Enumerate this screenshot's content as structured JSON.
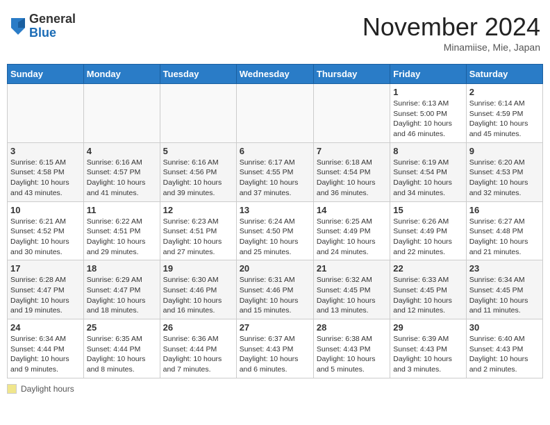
{
  "header": {
    "logo_general": "General",
    "logo_blue": "Blue",
    "month_title": "November 2024",
    "location": "Minamiise, Mie, Japan"
  },
  "weekdays": [
    "Sunday",
    "Monday",
    "Tuesday",
    "Wednesday",
    "Thursday",
    "Friday",
    "Saturday"
  ],
  "weeks": [
    [
      {
        "day": "",
        "info": ""
      },
      {
        "day": "",
        "info": ""
      },
      {
        "day": "",
        "info": ""
      },
      {
        "day": "",
        "info": ""
      },
      {
        "day": "",
        "info": ""
      },
      {
        "day": "1",
        "info": "Sunrise: 6:13 AM\nSunset: 5:00 PM\nDaylight: 10 hours and 46 minutes."
      },
      {
        "day": "2",
        "info": "Sunrise: 6:14 AM\nSunset: 4:59 PM\nDaylight: 10 hours and 45 minutes."
      }
    ],
    [
      {
        "day": "3",
        "info": "Sunrise: 6:15 AM\nSunset: 4:58 PM\nDaylight: 10 hours and 43 minutes."
      },
      {
        "day": "4",
        "info": "Sunrise: 6:16 AM\nSunset: 4:57 PM\nDaylight: 10 hours and 41 minutes."
      },
      {
        "day": "5",
        "info": "Sunrise: 6:16 AM\nSunset: 4:56 PM\nDaylight: 10 hours and 39 minutes."
      },
      {
        "day": "6",
        "info": "Sunrise: 6:17 AM\nSunset: 4:55 PM\nDaylight: 10 hours and 37 minutes."
      },
      {
        "day": "7",
        "info": "Sunrise: 6:18 AM\nSunset: 4:54 PM\nDaylight: 10 hours and 36 minutes."
      },
      {
        "day": "8",
        "info": "Sunrise: 6:19 AM\nSunset: 4:54 PM\nDaylight: 10 hours and 34 minutes."
      },
      {
        "day": "9",
        "info": "Sunrise: 6:20 AM\nSunset: 4:53 PM\nDaylight: 10 hours and 32 minutes."
      }
    ],
    [
      {
        "day": "10",
        "info": "Sunrise: 6:21 AM\nSunset: 4:52 PM\nDaylight: 10 hours and 30 minutes."
      },
      {
        "day": "11",
        "info": "Sunrise: 6:22 AM\nSunset: 4:51 PM\nDaylight: 10 hours and 29 minutes."
      },
      {
        "day": "12",
        "info": "Sunrise: 6:23 AM\nSunset: 4:51 PM\nDaylight: 10 hours and 27 minutes."
      },
      {
        "day": "13",
        "info": "Sunrise: 6:24 AM\nSunset: 4:50 PM\nDaylight: 10 hours and 25 minutes."
      },
      {
        "day": "14",
        "info": "Sunrise: 6:25 AM\nSunset: 4:49 PM\nDaylight: 10 hours and 24 minutes."
      },
      {
        "day": "15",
        "info": "Sunrise: 6:26 AM\nSunset: 4:49 PM\nDaylight: 10 hours and 22 minutes."
      },
      {
        "day": "16",
        "info": "Sunrise: 6:27 AM\nSunset: 4:48 PM\nDaylight: 10 hours and 21 minutes."
      }
    ],
    [
      {
        "day": "17",
        "info": "Sunrise: 6:28 AM\nSunset: 4:47 PM\nDaylight: 10 hours and 19 minutes."
      },
      {
        "day": "18",
        "info": "Sunrise: 6:29 AM\nSunset: 4:47 PM\nDaylight: 10 hours and 18 minutes."
      },
      {
        "day": "19",
        "info": "Sunrise: 6:30 AM\nSunset: 4:46 PM\nDaylight: 10 hours and 16 minutes."
      },
      {
        "day": "20",
        "info": "Sunrise: 6:31 AM\nSunset: 4:46 PM\nDaylight: 10 hours and 15 minutes."
      },
      {
        "day": "21",
        "info": "Sunrise: 6:32 AM\nSunset: 4:45 PM\nDaylight: 10 hours and 13 minutes."
      },
      {
        "day": "22",
        "info": "Sunrise: 6:33 AM\nSunset: 4:45 PM\nDaylight: 10 hours and 12 minutes."
      },
      {
        "day": "23",
        "info": "Sunrise: 6:34 AM\nSunset: 4:45 PM\nDaylight: 10 hours and 11 minutes."
      }
    ],
    [
      {
        "day": "24",
        "info": "Sunrise: 6:34 AM\nSunset: 4:44 PM\nDaylight: 10 hours and 9 minutes."
      },
      {
        "day": "25",
        "info": "Sunrise: 6:35 AM\nSunset: 4:44 PM\nDaylight: 10 hours and 8 minutes."
      },
      {
        "day": "26",
        "info": "Sunrise: 6:36 AM\nSunset: 4:44 PM\nDaylight: 10 hours and 7 minutes."
      },
      {
        "day": "27",
        "info": "Sunrise: 6:37 AM\nSunset: 4:43 PM\nDaylight: 10 hours and 6 minutes."
      },
      {
        "day": "28",
        "info": "Sunrise: 6:38 AM\nSunset: 4:43 PM\nDaylight: 10 hours and 5 minutes."
      },
      {
        "day": "29",
        "info": "Sunrise: 6:39 AM\nSunset: 4:43 PM\nDaylight: 10 hours and 3 minutes."
      },
      {
        "day": "30",
        "info": "Sunrise: 6:40 AM\nSunset: 4:43 PM\nDaylight: 10 hours and 2 minutes."
      }
    ]
  ],
  "footer": {
    "legend_label": "Daylight hours"
  }
}
